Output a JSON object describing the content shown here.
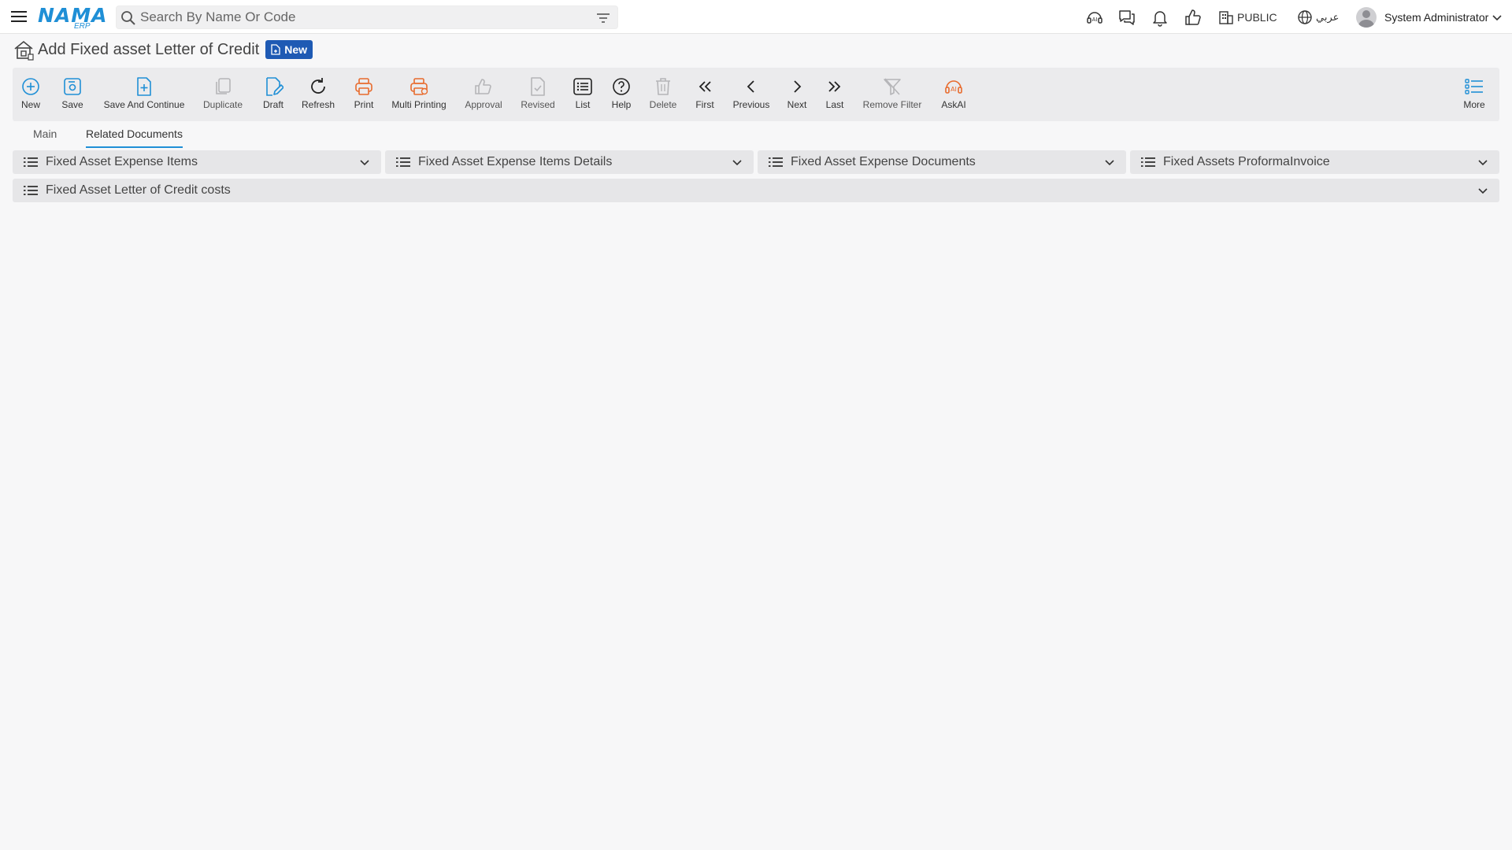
{
  "header": {
    "logo_text": "NAMA",
    "logo_sub": "ERP",
    "search_placeholder": "Search By Name Or Code",
    "public_label": "PUBLIC",
    "language_label": "عربي",
    "user_name": "System Administrator"
  },
  "page": {
    "title": "Add Fixed asset Letter of Credit",
    "status_badge": "New"
  },
  "toolbar": {
    "buttons": [
      {
        "label": "New",
        "icon": "plus-circle-icon",
        "color": "#1f8fd6"
      },
      {
        "label": "Save",
        "icon": "save-icon",
        "color": "#1f8fd6"
      },
      {
        "label": "Save And Continue",
        "icon": "file-plus-icon",
        "color": "#1f8fd6"
      },
      {
        "label": "Duplicate",
        "icon": "duplicate-icon",
        "color": "#b5b5b8"
      },
      {
        "label": "Draft",
        "icon": "draft-icon",
        "color": "#1f8fd6"
      },
      {
        "label": "Refresh",
        "icon": "refresh-icon",
        "color": "#222222"
      },
      {
        "label": "Print",
        "icon": "print-icon",
        "color": "#e86a2c"
      },
      {
        "label": "Multi Printing",
        "icon": "multi-print-icon",
        "color": "#e86a2c"
      },
      {
        "label": "Approval",
        "icon": "thumbs-up-icon",
        "color": "#b5b5b8"
      },
      {
        "label": "Revised",
        "icon": "revised-icon",
        "color": "#b5b5b8"
      },
      {
        "label": "List",
        "icon": "list-icon",
        "color": "#222222"
      },
      {
        "label": "Help",
        "icon": "help-icon",
        "color": "#222222"
      },
      {
        "label": "Delete",
        "icon": "trash-icon",
        "color": "#b5b5b8"
      },
      {
        "label": "First",
        "icon": "chevrons-left-icon",
        "color": "#222222"
      },
      {
        "label": "Previous",
        "icon": "chevron-left-icon",
        "color": "#222222"
      },
      {
        "label": "Next",
        "icon": "chevron-right-icon",
        "color": "#222222"
      },
      {
        "label": "Last",
        "icon": "chevrons-right-icon",
        "color": "#222222"
      },
      {
        "label": "Remove Filter",
        "icon": "remove-filter-icon",
        "color": "#b5b5b8"
      },
      {
        "label": "AskAI",
        "icon": "ai-icon",
        "color": "#e86a2c"
      }
    ],
    "more_label": "More"
  },
  "tabs": [
    {
      "label": "Main",
      "active": false
    },
    {
      "label": "Related Documents",
      "active": true
    }
  ],
  "panels": [
    {
      "label": "Fixed Asset Expense Items"
    },
    {
      "label": "Fixed Asset Expense Items Details"
    },
    {
      "label": "Fixed Asset Expense Documents"
    },
    {
      "label": "Fixed Assets ProformaInvoice"
    },
    {
      "label": "Fixed Asset Letter of Credit costs"
    }
  ],
  "colors": {
    "brand": "#1f8fd6",
    "badge": "#1e5ab4",
    "print_accent": "#e86a2c",
    "disabled": "#b5b5b8"
  }
}
